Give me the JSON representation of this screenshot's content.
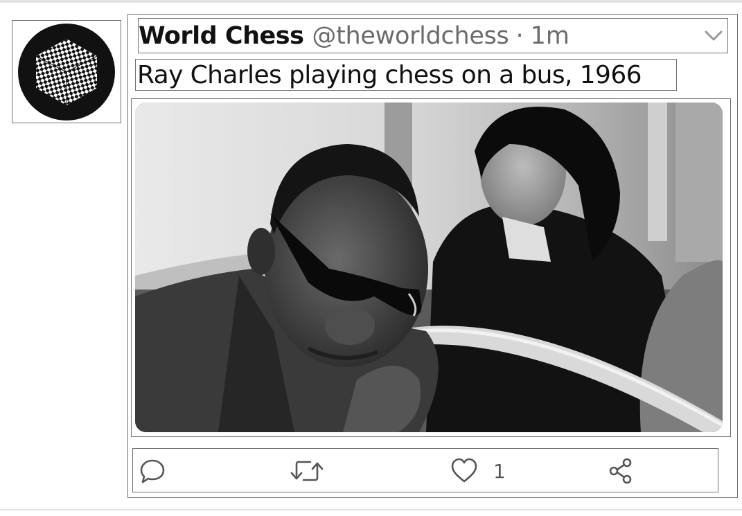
{
  "tweet": {
    "author_name": "World Chess",
    "author_handle": "@theworldchess",
    "separator": "·",
    "time": "1m",
    "text": "Ray Charles playing chess on a bus, 1966",
    "avatar_icon": "chess-hexagon-logo",
    "media_icon": "photo-ray-charles-bus",
    "menu_icon": "chevron-down-icon"
  },
  "actions": {
    "reply_icon": "reply-icon",
    "retweet_icon": "retweet-icon",
    "like_icon": "heart-icon",
    "like_count": "1",
    "share_icon": "share-icon"
  },
  "colors": {
    "name": "#111111",
    "muted": "#6b6b6b",
    "icon": "#555555",
    "border": "#6f6f6f"
  }
}
